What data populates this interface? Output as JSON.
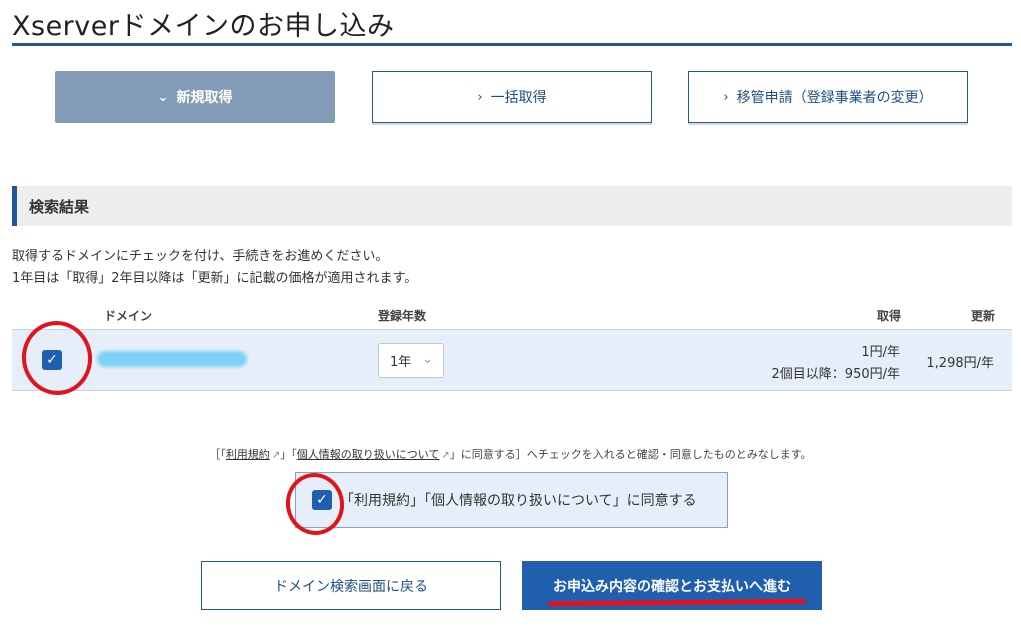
{
  "header": {
    "title": "Xserverドメインのお申し込み"
  },
  "tabs": [
    {
      "label": "新規取得",
      "chevron": "⌄",
      "active": true
    },
    {
      "label": "一括取得",
      "chevron": "›",
      "active": false
    },
    {
      "label": "移管申請（登録事業者の変更）",
      "chevron": "›",
      "active": false
    }
  ],
  "results": {
    "heading": "検索結果",
    "desc_line1": "取得するドメインにチェックを付け、手続きをお進めください。",
    "desc_line2": "1年目は「取得」2年目以降は「更新」に記載の価格が適用されます。",
    "columns": {
      "domain": "ドメイン",
      "years": "登録年数",
      "acquire": "取得",
      "renew": "更新"
    },
    "row": {
      "checked": true,
      "years_value": "1年",
      "acquire_price": "1円/年",
      "acquire_note": "2個目以降：950円/年",
      "renew_price": "1,298円/年"
    }
  },
  "agreement": {
    "note_open": "［「",
    "terms_link": "利用規約",
    "mid1": "」「",
    "privacy_link": "個人情報の取り扱いについて",
    "note_close": "」に同意する］へチェックを入れると確認・同意したものとみなします。",
    "checkbox_label": "「利用規約」「個人情報の取り扱いについて」に同意する",
    "checked": true
  },
  "buttons": {
    "back": "ドメイン検索画面に戻る",
    "next": "お申込み内容の確認とお支払いへ進む"
  },
  "colors": {
    "primary": "#1f5fae",
    "accent_line": "#1f5a96",
    "row_bg": "#e6eff9",
    "tab_active": "#829cb7",
    "annotation_red": "#e3131b"
  }
}
